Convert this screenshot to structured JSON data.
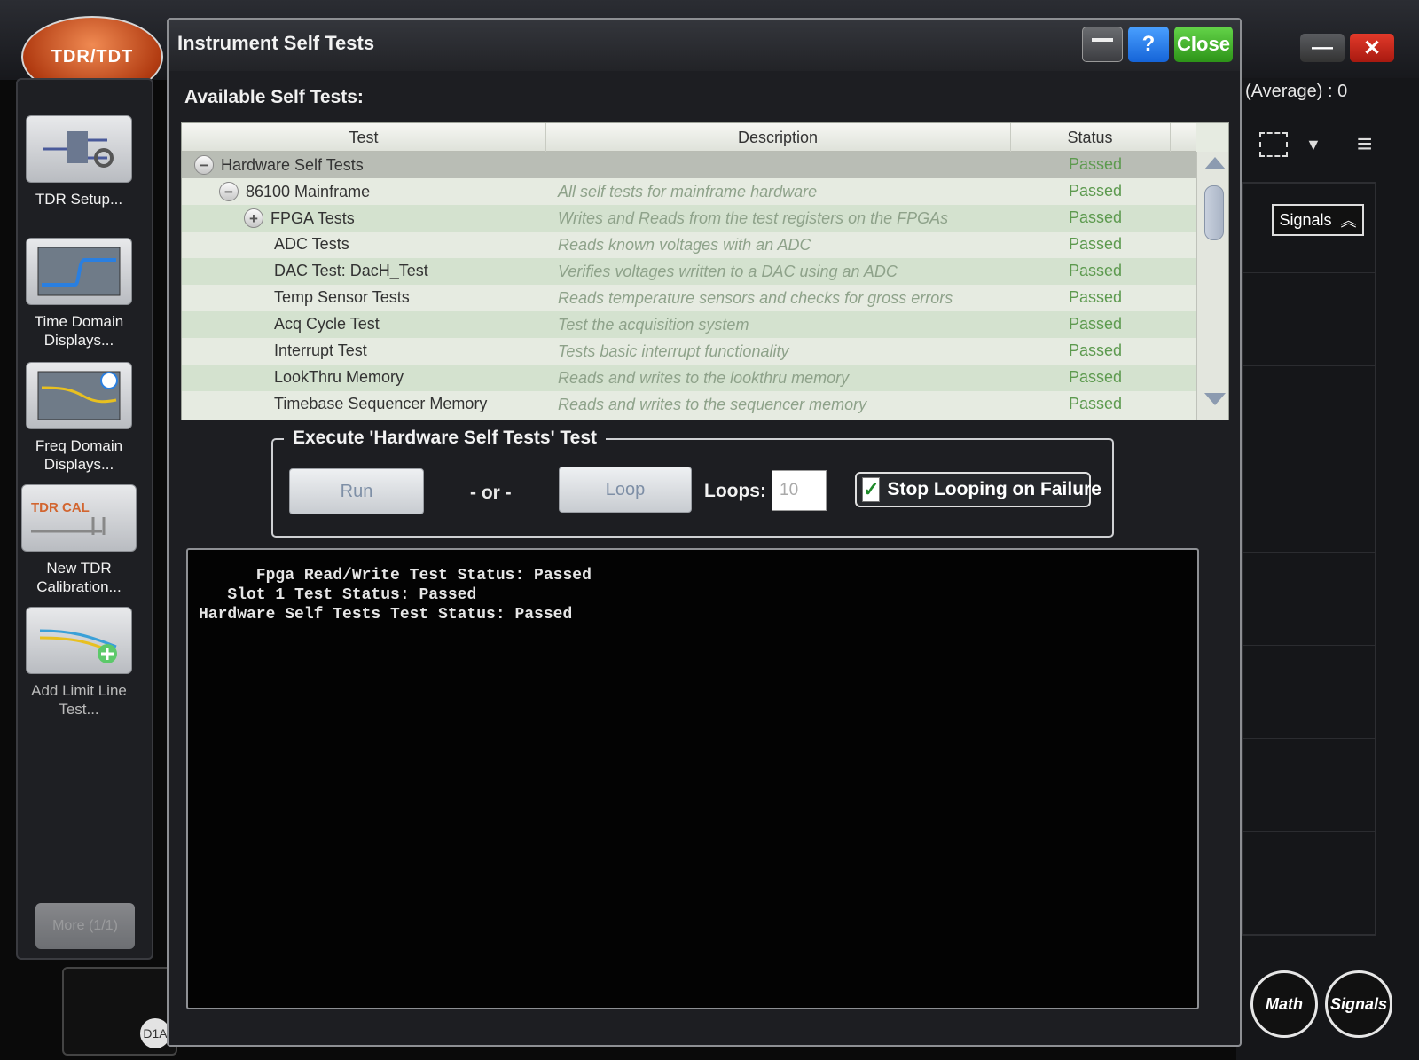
{
  "app": {
    "logo": "TDR/TDT",
    "side_buttons": [
      {
        "label": "TDR Setup..."
      },
      {
        "label": "Time Domain Displays..."
      },
      {
        "label": "Freq Domain Displays..."
      },
      {
        "label": "New TDR Calibration...",
        "icon_text": "TDR CAL"
      },
      {
        "label": "Add Limit Line Test..."
      }
    ],
    "more_label": "More (1/1)",
    "d1a_label": "D1A",
    "average_label": "(Average) : 0",
    "signals_tab_label": "Signals",
    "math_label": "Math",
    "signals_label": "Signals"
  },
  "dialog": {
    "title": "Instrument Self Tests",
    "help_label": "?",
    "close_label": "Close",
    "available_label": "Available Self Tests:",
    "columns": [
      "Test",
      "Description",
      "Status"
    ],
    "rows": [
      {
        "name": "Hardware Self Tests",
        "description": "",
        "status": "Passed",
        "expander": "−"
      },
      {
        "name": "86100 Mainframe",
        "description": "All self tests for mainframe hardware",
        "status": "Passed",
        "expander": "−"
      },
      {
        "name": "FPGA Tests",
        "description": "Writes and Reads from the test registers on the FPGAs",
        "status": "Passed",
        "expander": "+"
      },
      {
        "name": "ADC Tests",
        "description": "Reads known voltages with an ADC",
        "status": "Passed",
        "expander": ""
      },
      {
        "name": "DAC Test: DacH_Test",
        "description": "Verifies voltages written to a DAC using an ADC",
        "status": "Passed",
        "expander": ""
      },
      {
        "name": "Temp Sensor Tests",
        "description": "Reads temperature sensors and checks for gross errors",
        "status": "Passed",
        "expander": ""
      },
      {
        "name": "Acq Cycle Test",
        "description": "Test the acquisition system",
        "status": "Passed",
        "expander": ""
      },
      {
        "name": "Interrupt Test",
        "description": "Tests basic interrupt functionality",
        "status": "Passed",
        "expander": ""
      },
      {
        "name": "LookThru Memory",
        "description": "Reads and writes to the lookthru memory",
        "status": "Passed",
        "expander": ""
      },
      {
        "name": "Timebase Sequencer Memory",
        "description": "Reads and writes to the sequencer memory",
        "status": "Passed",
        "expander": ""
      }
    ],
    "execute": {
      "title": "Execute 'Hardware Self Tests' Test",
      "run_label": "Run",
      "or_label": "- or -",
      "loop_label": "Loop",
      "loops_label": "Loops:",
      "loops_value": "10",
      "stop_label": "Stop Looping on Failure",
      "stop_checked": true
    },
    "console_lines": [
      "      Fpga Read/Write Test Status: Passed",
      "   Slot 1 Test Status: Passed",
      "Hardware Self Tests Test Status: Passed"
    ]
  },
  "colors": {
    "passed": "#5d9a4f",
    "close_button": "#2d9418",
    "help_button": "#1564d8"
  }
}
